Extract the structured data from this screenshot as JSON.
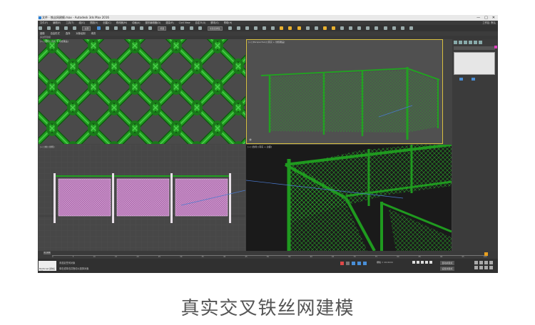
{
  "titlebar": {
    "title": "文件 · 铁丝网建模.max - Autodesk 3ds Max 2016",
    "controls": [
      "—",
      "□",
      "✕"
    ]
  },
  "menubar": {
    "items": [
      "文件(F)",
      "编辑(E)",
      "工具(T)",
      "组(G)",
      "视图(V)",
      "创建(C)",
      "修改器(M)",
      "动画(A)",
      "图形编辑器(D)",
      "渲染(R)",
      "Civil View",
      "自定义(U)",
      "脚本(S)",
      "帮助(H)"
    ],
    "workspace": "工作区: 默认"
  },
  "toolbar": {
    "view_select": "视图",
    "selection_set": "创建选择集"
  },
  "ribbon": {
    "tabs": [
      "建模",
      "自由形式",
      "选择",
      "对象绘制",
      "填充"
    ],
    "sub": "多边形建模"
  },
  "viewports": [
    {
      "label": "[+] [透视] [真实 + 线框覆盖]"
    },
    {
      "label": "[+] [Perspective] [真实 + 线框覆盖]"
    },
    {
      "label": "[+] [前] [线框]"
    },
    {
      "label": "[+] [透视] [真实 + 边面]"
    }
  ],
  "timeline": {
    "frame": "0 / 100",
    "ticks": [
      "0",
      "5",
      "10",
      "15",
      "20",
      "25",
      "30",
      "35",
      "40",
      "45",
      "50",
      "55",
      "60",
      "65",
      "70",
      "75",
      "80",
      "85",
      "90",
      "95",
      "100"
    ]
  },
  "statusbar": {
    "maxscript": "MAXScript 迷你侦听器",
    "selected": "未选定任何对象",
    "hint": "单击或单击并拖动以选择对象",
    "grid": "栅格 = 10.0mm",
    "autokey": "自动关键点",
    "setkey": "设置关键点",
    "selected_dd": "选定对象"
  },
  "caption": "真实交叉铁丝网建模",
  "colors": {
    "fence_green": "#1e8c1e",
    "mesh_pink": "#c888c8"
  }
}
